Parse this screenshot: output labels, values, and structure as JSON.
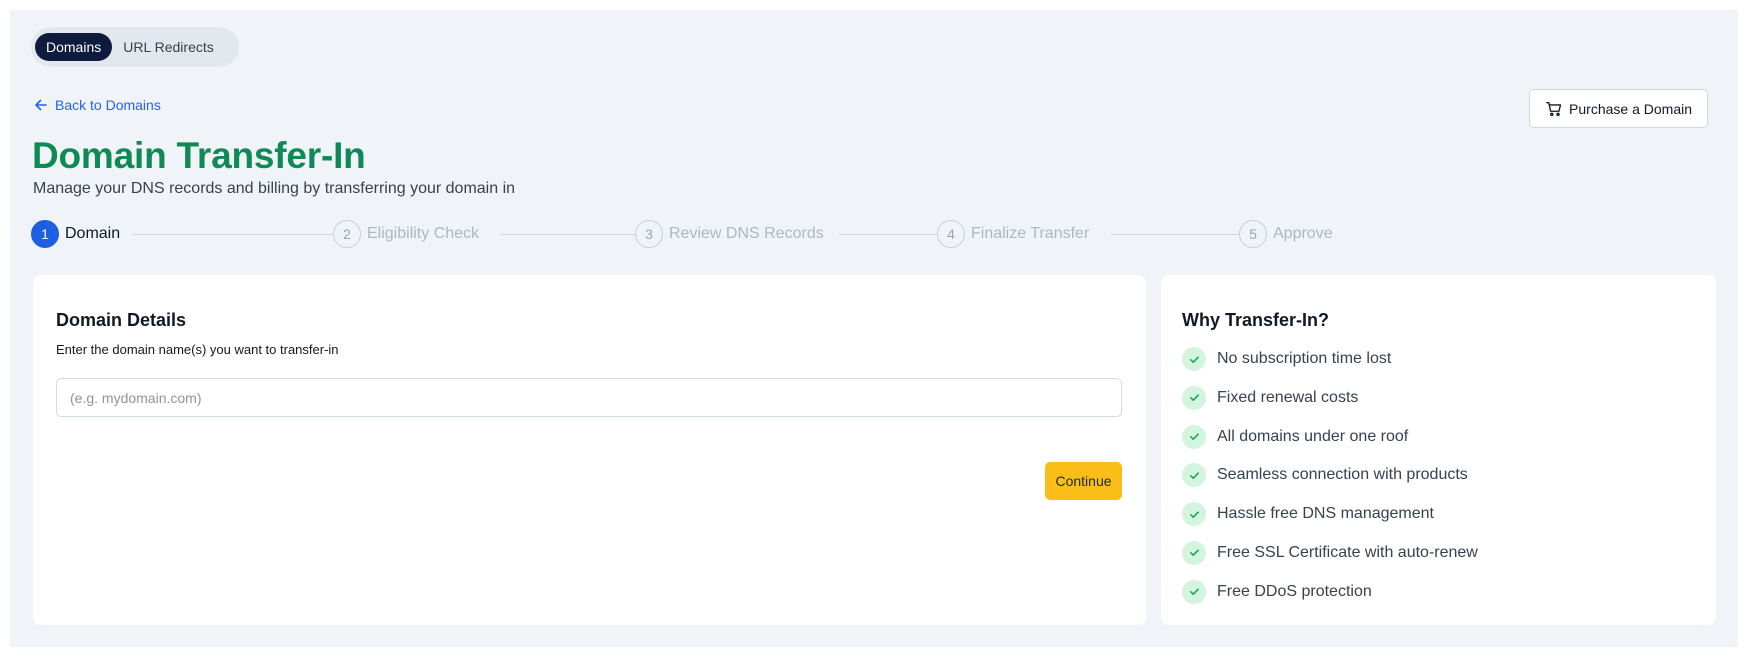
{
  "tabs": [
    {
      "label": "Domains",
      "active": true
    },
    {
      "label": "URL Redirects",
      "active": false
    }
  ],
  "back_link": {
    "label": "Back to Domains",
    "icon": "arrow-left-icon"
  },
  "purchase_button": {
    "label": "Purchase a Domain",
    "icon": "cart-icon"
  },
  "page": {
    "title": "Domain Transfer-In",
    "subtitle": "Manage your DNS records and billing by transferring your domain in"
  },
  "stepper": {
    "steps": [
      {
        "number": "1",
        "label": "Domain",
        "active": true
      },
      {
        "number": "2",
        "label": "Eligibility Check",
        "active": false
      },
      {
        "number": "3",
        "label": "Review DNS Records",
        "active": false
      },
      {
        "number": "4",
        "label": "Finalize Transfer",
        "active": false
      },
      {
        "number": "5",
        "label": "Approve",
        "active": false
      }
    ]
  },
  "domain_details": {
    "title": "Domain Details",
    "description": "Enter the domain name(s) you want to transfer-in",
    "input_value": "",
    "input_placeholder": "(e.g. mydomain.com)",
    "continue_label": "Continue"
  },
  "why_transfer": {
    "title": "Why Transfer-In?",
    "items": [
      "No subscription time lost",
      "Fixed renewal costs",
      "All domains under one roof",
      "Seamless connection with products",
      "Hassle free DNS management",
      "Free SSL Certificate with auto-renew",
      "Free DDoS protection"
    ]
  },
  "colors": {
    "title_green": "#0f8a55",
    "link_blue": "#2563eb",
    "step_active": "#1d5fe0",
    "continue_yellow": "#fbbd18",
    "tab_active_bg": "#0f1b3d",
    "check_bg": "#d3f5df",
    "check_mark": "#16a34a"
  }
}
